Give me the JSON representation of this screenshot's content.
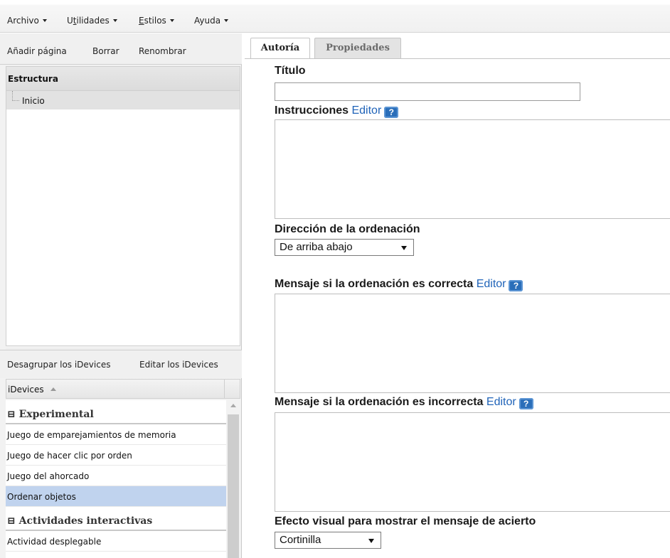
{
  "menubar": {
    "items": [
      {
        "label": "Archivo"
      },
      {
        "label_pre": "U",
        "label_u": "t",
        "label_post": "ilidades"
      },
      {
        "label_pre": "",
        "label_u": "E",
        "label_post": "stilos"
      },
      {
        "label": "Ayuda"
      }
    ]
  },
  "page_toolbar": {
    "add_page": "Añadir página",
    "delete": "Borrar",
    "rename": "Renombrar"
  },
  "structure": {
    "header": "Estructura",
    "nodes": [
      {
        "label": "Inicio"
      }
    ]
  },
  "nav_buttons": [
    {
      "icon": "move-top-icon"
    },
    {
      "icon": "move-bottom-icon"
    },
    {
      "icon": "move-up-icon"
    },
    {
      "icon": "move-down-icon"
    }
  ],
  "idevices_toolbar": {
    "ungroup": "Desagrupar los iDevices",
    "edit": "Editar los iDevices"
  },
  "idevices_list": {
    "header": "iDevices",
    "groups": [
      {
        "name": "Experimental",
        "items": [
          "Juego de emparejamientos de memoria",
          "Juego de hacer clic por orden",
          "Juego del ahorcado",
          "Ordenar objetos"
        ],
        "selected_index": 3
      },
      {
        "name": "Actividades interactivas",
        "items": [
          "Actividad desplegable"
        ]
      }
    ],
    "collapse_symbol": "⊟"
  },
  "tabs": [
    {
      "label": "Autoría",
      "active": true
    },
    {
      "label": "Propiedades",
      "active": false
    }
  ],
  "form": {
    "titulo_label": "Título",
    "titulo_value": "",
    "instrucciones_label": "Instrucciones",
    "editor_link": "Editor",
    "help_symbol": "?",
    "direccion_label": "Dirección de la ordenación",
    "direccion_value": "De arriba abajo",
    "correcta_label": "Mensaje si la ordenación es correcta",
    "incorrecta_label": "Mensaje si la ordenación es incorrecta",
    "efecto_label": "Efecto visual para mostrar el mensaje de acierto",
    "efecto_value": "Cortinilla"
  },
  "colors": {
    "selected_row": "#c0d3ee",
    "link": "#1f63b8",
    "help_icon": "#2a6eb9"
  }
}
